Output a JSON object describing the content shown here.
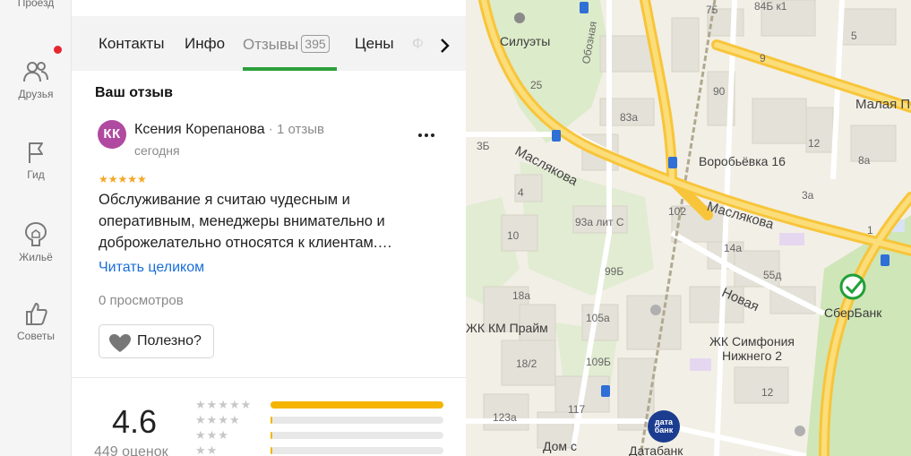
{
  "rail": {
    "items": [
      {
        "label": "Проезд",
        "icon": "route-icon"
      },
      {
        "label": "Друзья",
        "icon": "friends-icon"
      },
      {
        "label": "Гид",
        "icon": "flag-icon"
      },
      {
        "label": "Жильё",
        "icon": "home-icon"
      },
      {
        "label": "Советы",
        "icon": "thumbs-up-icon"
      }
    ]
  },
  "tabs": {
    "items": [
      {
        "label": "Контакты"
      },
      {
        "label": "Инфо"
      },
      {
        "label": "Отзывы",
        "count": "395"
      },
      {
        "label": "Цены"
      }
    ],
    "faded": "Ф",
    "active": "Отзывы",
    "accent": "#2b9f3b"
  },
  "review": {
    "section_title": "Ваш отзыв",
    "avatar_initials": "КК",
    "avatar_color": "#b04aa0",
    "author": "Ксения Корепанова",
    "separator": "·",
    "author_reviews": "1 отзыв",
    "date": "сегодня",
    "rating_stars": 5,
    "stars_text": "★★★★★",
    "text": "Обслуживание я считаю чудесным и оперативным, менеджеры внимательно и доброжелательно относятся к клиентам.…",
    "read_more": "Читать целиком",
    "views": "0 просмотров",
    "useful_label": "Полезно?"
  },
  "rating": {
    "value": "4.6",
    "count": "449 оценок",
    "distribution": [
      {
        "stars": "★★★★★",
        "fraction": 1.0
      },
      {
        "stars": "★★★★",
        "fraction": 0.01
      },
      {
        "stars": "★★★",
        "fraction": 0.01
      },
      {
        "stars": "★★",
        "fraction": 0.01
      }
    ]
  },
  "map": {
    "labels": {
      "siluety": "Силуэты",
      "obeznaya": "Обозная",
      "maslyakova1": "Маслякова",
      "maslyakova2": "Маслякова",
      "vorobyevka": "Воробьёвка 16",
      "malaya": "Малая Пе",
      "novaya": "Новая",
      "zhk_km": "ЖК КМ Прайм",
      "zhk_simfonia1": "ЖК Симфония",
      "zhk_simfonia2": "Нижнего 2",
      "sberbank": "СберБанк",
      "databank": "Датабанк",
      "dom": "Дом с",
      "n75": "75",
      "n84": "84Б к1",
      "n5": "5",
      "n9": "9",
      "n25": "25",
      "n90": "90",
      "n83a": "83а",
      "n3b": "3Б",
      "n12": "12",
      "n8a": "8а",
      "n4": "4",
      "n3a": "3а",
      "n1": "1",
      "n102": "102",
      "n93": "93а лит С",
      "n10": "10",
      "n14a": "14а",
      "n99b": "99Б",
      "n55d": "55д",
      "n18a": "18а",
      "n105a": "105а",
      "n18_2": "18/2",
      "n109b": "109Б",
      "n12b": "12",
      "n117": "117",
      "n123a": "123а"
    },
    "databank_logo": "дата банк"
  }
}
